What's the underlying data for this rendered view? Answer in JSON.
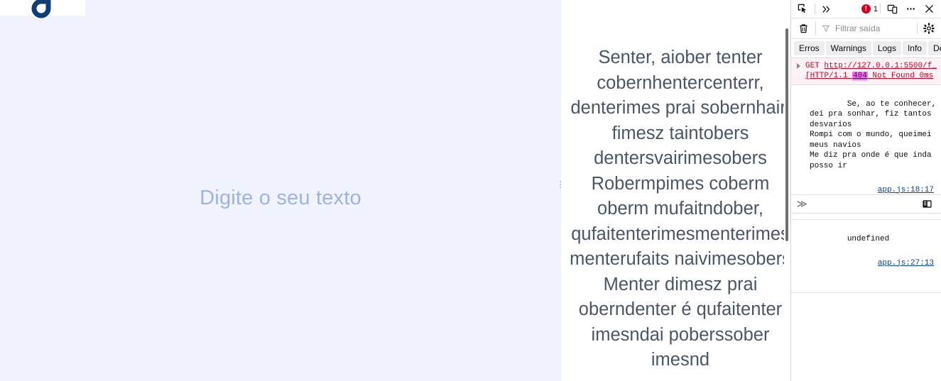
{
  "app": {
    "logo_name": "brand-droplet-logo",
    "background_color": "#f0f3fc",
    "accent_color": "#9eb3e0"
  },
  "editor": {
    "placeholder": "Digite o seu texto",
    "value": ""
  },
  "preview": {
    "text": "Senter, aiober tenter cobernhentercenterr, denterimes prai sobernhair, fimesz taintobers dentersvairimesobers Robermpimes coberm oberm mufaitndober, qufaitenterimesmenterimes menterufaits naivimesobers Menter dimesz prai oberndenter é qufaitenter imesndai poberssober imesnd"
  },
  "devtools": {
    "toolbar": {
      "picker_icon": "element-picker-icon",
      "overflow_icon": "chevrons-right-icon",
      "error_count": "1",
      "responsive_icon": "responsive-design-mode-icon",
      "more_icon": "ellipsis-icon",
      "close_icon": "close-icon"
    },
    "filterbar": {
      "trash_icon": "trash-icon",
      "filter_icon": "funnel-icon",
      "filter_placeholder": "Filtrar saída",
      "filter_value": "",
      "settings_icon": "gear-icon"
    },
    "tabs": [
      {
        "label": "Erros"
      },
      {
        "label": "Warnings"
      },
      {
        "label": "Logs"
      },
      {
        "label": "Info"
      },
      {
        "label": "Debu"
      }
    ],
    "network_error": {
      "method": "GET",
      "url": "http://127.0.0.1:5500/f_",
      "protocol_prefix": "[HTTP/1.1 ",
      "status": "404",
      "status_text": " Not Found 0ms"
    },
    "logs": [
      {
        "message": "Se, ao te conhecer, dei pra sonhar, fiz tantos desvarios\nRompi com o mundo, queimei meus navios\nMe diz pra onde é que inda posso ir",
        "source": "app.js:18:17"
      },
      {
        "message": "undefined",
        "source": "app.js:27:13"
      }
    ],
    "input": {
      "prompt": "≫",
      "value": "",
      "split_panel_icon": "split-console-icon"
    }
  }
}
